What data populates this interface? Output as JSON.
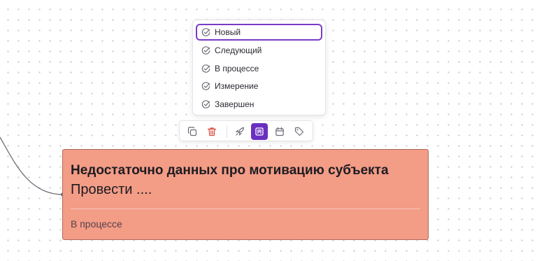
{
  "status_menu": {
    "items": [
      {
        "label": "Новый",
        "selected": true
      },
      {
        "label": "Следующий",
        "selected": false
      },
      {
        "label": "В процессе",
        "selected": false
      },
      {
        "label": "Измерение",
        "selected": false
      },
      {
        "label": "Завершен",
        "selected": false
      }
    ]
  },
  "toolbar": {
    "buttons": [
      "copy-icon",
      "trash-icon",
      "rocket-icon",
      "status-icon",
      "calendar-icon",
      "tag-icon"
    ],
    "active": "status-icon",
    "accent_color": "#6a2fc0",
    "delete_color": "#d9463a"
  },
  "card": {
    "title": "Недостаточно данных про мотивацию субъекта",
    "subtitle": "Провести ....",
    "status": "В процессе",
    "background_color": "#f39c86"
  }
}
